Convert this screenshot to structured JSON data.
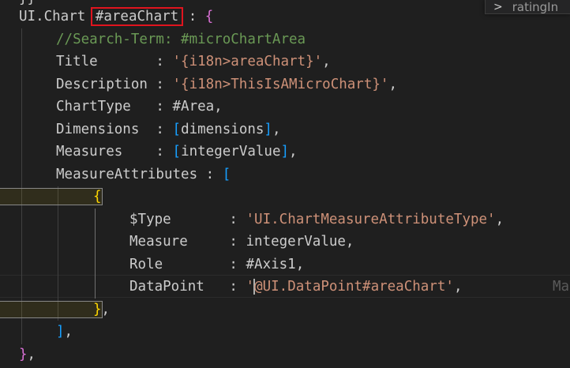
{
  "peek": {
    "label": "ratingIn",
    "chevron_icon": "chevron-right-icon"
  },
  "code": {
    "l0_stub": "}}",
    "l1_prefix": "UI.Chart ",
    "l1_key": "#areaChart",
    "l1_sep": " : ",
    "l1_brace": "{",
    "l2_comment": "//Search-Term: #microChartArea",
    "l3_key": "Title       : ",
    "l3_val": "'{i18n>areaChart}'",
    "l3_end": ",",
    "l4_key": "Description : ",
    "l4_val": "'{i18n>ThisIsAMicroChart}'",
    "l4_end": ",",
    "l5_key": "ChartType   : #Area,",
    "l6_key": "Dimensions  : ",
    "l6_open": "[",
    "l6_val": "dimensions",
    "l6_close": "]",
    "l6_end": ",",
    "l7_key": "Measures    : ",
    "l7_open": "[",
    "l7_val": "integerValue",
    "l7_close": "]",
    "l7_end": ",",
    "l8_key": "MeasureAttributes : ",
    "l8_open": "[",
    "l9_open": "{",
    "l10_key": "$Type       : ",
    "l10_val": "'UI.ChartMeasureAttributeType'",
    "l10_end": ",",
    "l11_key": "Measure     : integerValue,",
    "l12_key": "Role        : #Axis1,",
    "l13_key": "DataPoint   : ",
    "l13_q": "'",
    "l13_val": "@UI.DataPoint#areaChart'",
    "l13_end": ",",
    "l13_ghost": "Ma",
    "l14_close": "}",
    "l14_end": ",",
    "l15_close": "]",
    "l15_end": ",",
    "l16_close": "}",
    "l16_end": ","
  }
}
